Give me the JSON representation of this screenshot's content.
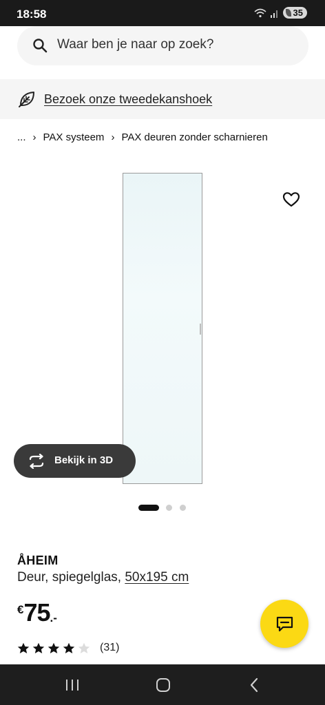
{
  "status_bar": {
    "time": "18:58",
    "battery": "35"
  },
  "search": {
    "placeholder": "Waar ben je naar op zoek?"
  },
  "promo": {
    "link_text": "Bezoek onze tweedekanshoek"
  },
  "breadcrumb": {
    "items": [
      "...",
      "PAX systeem",
      "PAX deuren zonder scharnieren"
    ]
  },
  "gallery": {
    "view3d_label": "Bekijk in 3D",
    "current_slide": 1,
    "total_slides": 3
  },
  "product": {
    "name": "ÅHEIM",
    "description": "Deur, spiegelglas, ",
    "size": "50x195 cm",
    "price_currency": "€",
    "price_amount": "75",
    "price_decimal": ".-",
    "rating_value": 4,
    "rating_max": 5,
    "rating_count": "(31)"
  },
  "colors": {
    "chat_accent": "#fbd914",
    "view3d_bg": "#3a3a3a"
  },
  "icons": [
    "search-icon",
    "leaf-icon",
    "heart-icon",
    "rotate-3d-icon",
    "star-icon",
    "chat-icon",
    "recent-apps-icon",
    "home-icon",
    "back-icon"
  ]
}
